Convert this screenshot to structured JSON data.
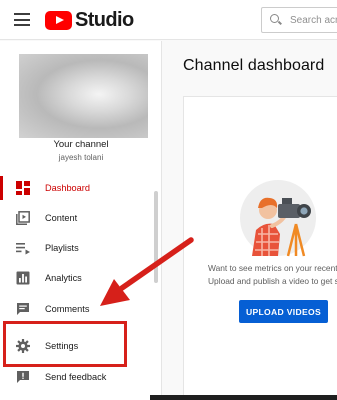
{
  "header": {
    "logo_text": "Studio",
    "search_placeholder": "Search acr"
  },
  "sidebar": {
    "channel_label": "Your channel",
    "channel_name": "jayesh tolani",
    "items": [
      {
        "label": "Dashboard",
        "icon": "dashboard-icon",
        "active": true
      },
      {
        "label": "Content",
        "icon": "content-icon"
      },
      {
        "label": "Playlists",
        "icon": "playlists-icon"
      },
      {
        "label": "Analytics",
        "icon": "analytics-icon"
      },
      {
        "label": "Comments",
        "icon": "comments-icon"
      },
      {
        "label": "Settings",
        "icon": "gear-icon"
      },
      {
        "label": "Send feedback",
        "icon": "feedback-icon"
      }
    ]
  },
  "main": {
    "title": "Channel dashboard",
    "metrics_line1": "Want to see metrics on your recent",
    "metrics_line2": "Upload and publish a video to get st",
    "upload_button": "UPLOAD VIDEOS"
  },
  "colors": {
    "accent": "#cc0000",
    "brand_red": "#ff0000",
    "button_blue": "#065fd4",
    "annotation_red": "#d6201a"
  }
}
